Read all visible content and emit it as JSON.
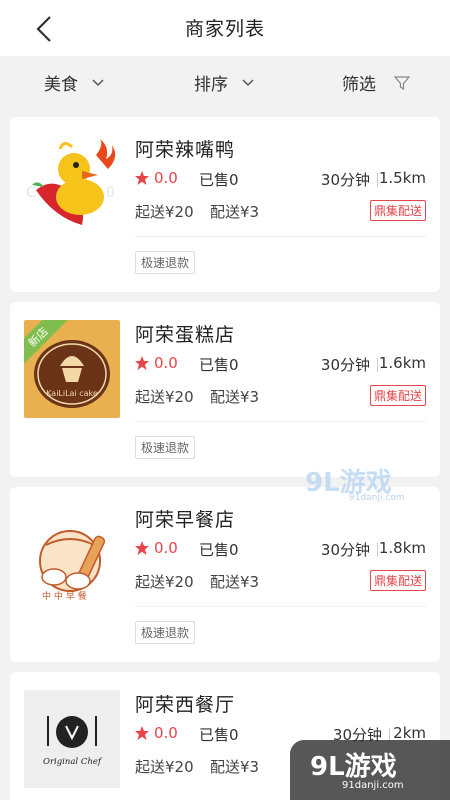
{
  "header": {
    "title": "商家列表",
    "back_icon": "back-chevron-icon"
  },
  "filters": {
    "category": "美食",
    "sort": "排序",
    "filter": "筛选"
  },
  "stores": [
    {
      "name": "阿荣辣嘴鸭",
      "rating": "0.0",
      "sold": "已售0",
      "time": "30分钟",
      "distance": "1.5km",
      "min_order": "起送¥20",
      "delivery_fee": "配送¥3",
      "badge": "鼎集配送",
      "tag": "极速退款"
    },
    {
      "name": "阿荣蛋糕店",
      "rating": "0.0",
      "sold": "已售0",
      "time": "30分钟",
      "distance": "1.6km",
      "min_order": "起送¥20",
      "delivery_fee": "配送¥3",
      "badge": "鼎集配送",
      "tag": "极速退款",
      "ribbon": "新店",
      "logo_text": "KaiLiLai cake"
    },
    {
      "name": "阿荣早餐店",
      "rating": "0.0",
      "sold": "已售0",
      "time": "30分钟",
      "distance": "1.8km",
      "min_order": "起送¥20",
      "delivery_fee": "配送¥3",
      "badge": "鼎集配送",
      "tag": "极速退款"
    },
    {
      "name": "阿荣西餐厅",
      "rating": "0.0",
      "sold": "已售0",
      "time": "30分钟",
      "distance": "2km",
      "min_order": "起送¥20",
      "delivery_fee": "配送¥3",
      "logo_text": "Original Chef"
    }
  ],
  "watermark": {
    "logo": "9L游戏",
    "site": "91danji.com"
  },
  "colors": {
    "accent": "#e6454a",
    "background": "#f2f2f2",
    "new_ribbon": "#7fbe4e"
  }
}
